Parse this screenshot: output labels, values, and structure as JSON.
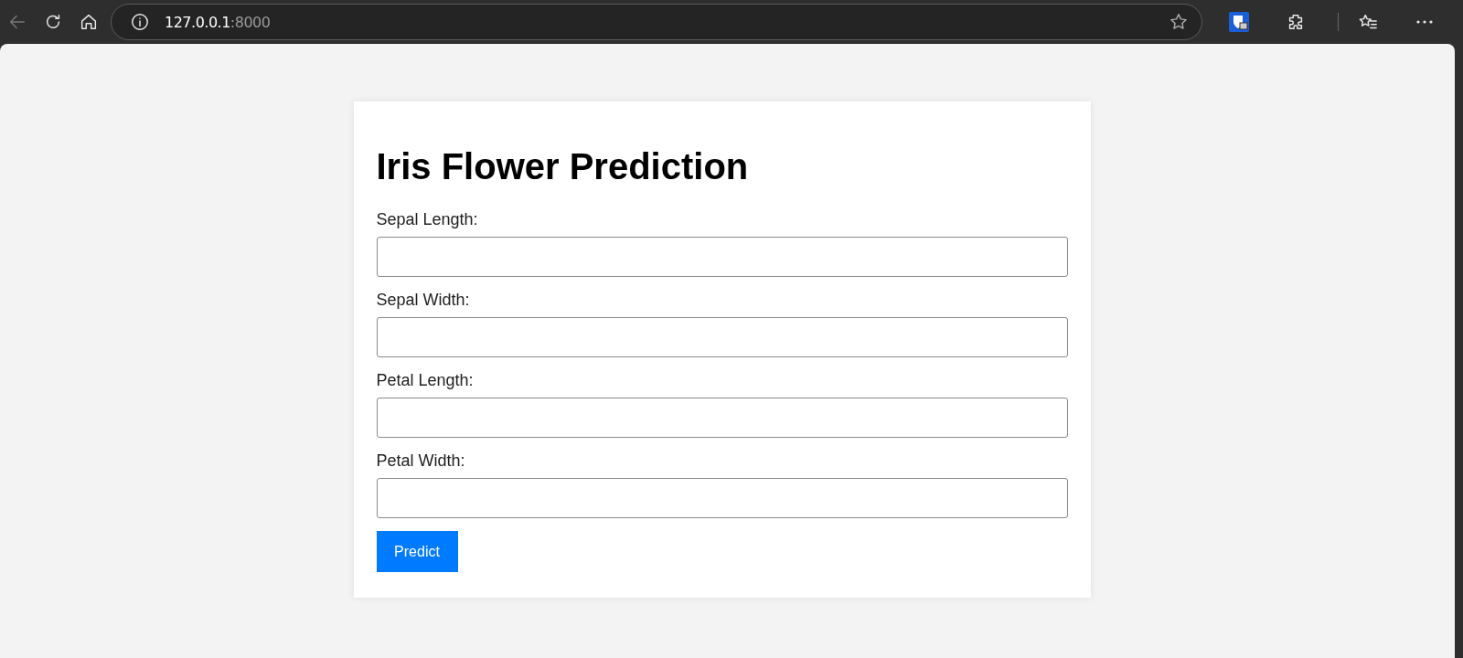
{
  "browser": {
    "url_host": "127.0.0.1",
    "url_port": ":8000"
  },
  "page": {
    "title": "Iris Flower Prediction",
    "fields": [
      {
        "label": "Sepal Length:"
      },
      {
        "label": "Sepal Width:"
      },
      {
        "label": "Petal Length:"
      },
      {
        "label": "Petal Width:"
      }
    ],
    "button": "Predict"
  }
}
